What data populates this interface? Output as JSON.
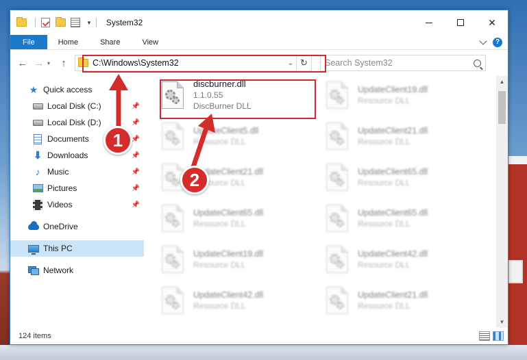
{
  "window": {
    "title": "System32",
    "controls": {
      "minimize": "—",
      "maximize": "☐",
      "close": "✕"
    }
  },
  "ribbon": {
    "tabs": [
      "File",
      "Home",
      "Share",
      "View"
    ],
    "help": "?"
  },
  "navigation": {
    "back": "←",
    "forward": "→",
    "up": "↑",
    "address": "C:\\Windows\\System32",
    "search_placeholder": "Search System32"
  },
  "sidebar": {
    "quick_access": "Quick access",
    "items": [
      {
        "label": "Local Disk (C:)",
        "icon": "drive-icon",
        "pinned": true
      },
      {
        "label": "Local Disk (D:)",
        "icon": "drive-icon",
        "pinned": true
      },
      {
        "label": "Documents",
        "icon": "documents-icon",
        "pinned": true
      },
      {
        "label": "Downloads",
        "icon": "downloads-icon",
        "pinned": true
      },
      {
        "label": "Music",
        "icon": "music-icon",
        "pinned": true
      },
      {
        "label": "Pictures",
        "icon": "pictures-icon",
        "pinned": true
      },
      {
        "label": "Videos",
        "icon": "videos-icon",
        "pinned": true
      }
    ],
    "onedrive": "OneDrive",
    "this_pc": "This PC",
    "network": "Network",
    "pin_glyph": "📌"
  },
  "files": [
    {
      "name": "discburner.dll",
      "line2": "1.1.0.55",
      "line3": "DiscBurner DLL",
      "blurred": false
    },
    {
      "name": "UpdateClient19.dll",
      "line2": "Resource DLL",
      "blurred": true
    },
    {
      "name": "UpdateClient5.dll",
      "line2": "Resource DLL",
      "blurred": true
    },
    {
      "name": "UpdateClient21.dll",
      "line2": "Resource DLL",
      "blurred": true
    },
    {
      "name": "UpdateClient21.dll",
      "line2": "Resource DLL",
      "blurred": true
    },
    {
      "name": "UpdateClient65.dll",
      "line2": "Resource DLL",
      "blurred": true
    },
    {
      "name": "UpdateClient65.dll",
      "line2": "Resource DLL",
      "blurred": true
    },
    {
      "name": "UpdateClient65.dll",
      "line2": "Resource DLL",
      "blurred": true
    },
    {
      "name": "UpdateClient19.dll",
      "line2": "Resource DLL",
      "blurred": true
    },
    {
      "name": "UpdateClient42.dll",
      "line2": "Resource DLL",
      "blurred": true
    },
    {
      "name": "UpdateClient42.dll",
      "line2": "Resource DLL",
      "blurred": true
    },
    {
      "name": "UpdateClient21.dll",
      "line2": "Resource DLL",
      "blurred": true
    }
  ],
  "status": {
    "item_count": "124 items"
  },
  "annotations": {
    "step1": "1",
    "step2": "2",
    "color": "#d0282e"
  }
}
